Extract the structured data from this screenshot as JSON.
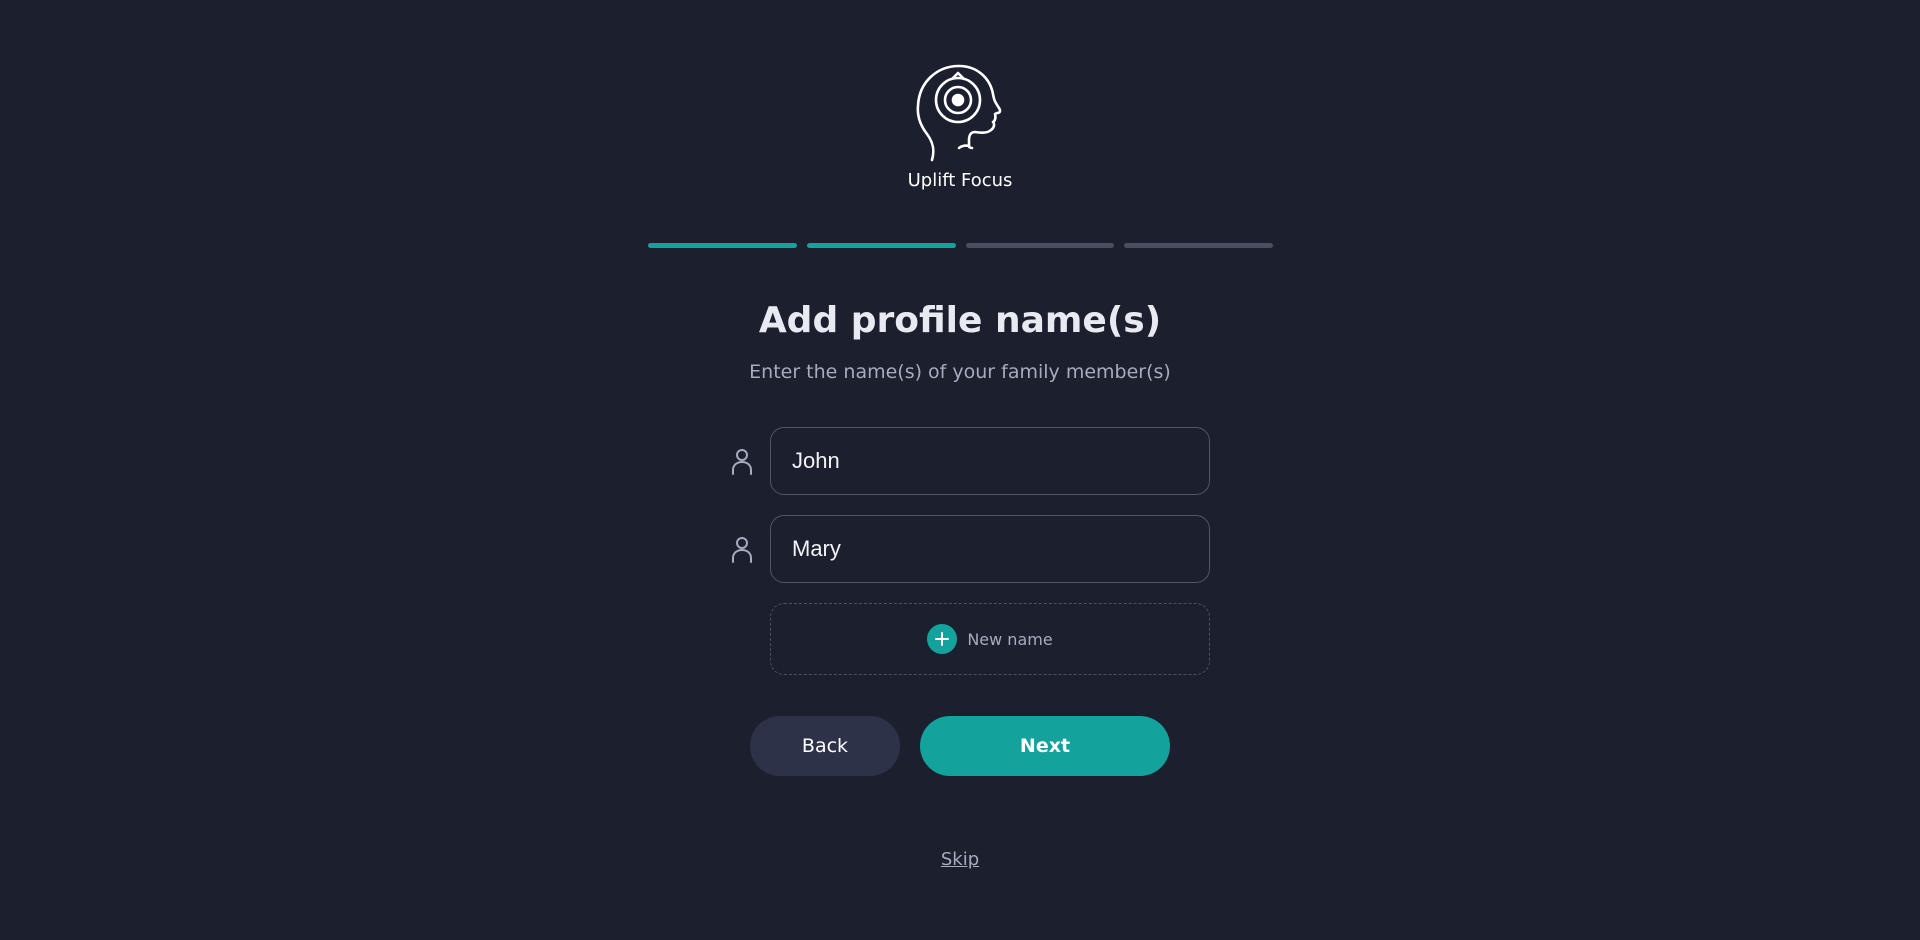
{
  "brand": {
    "name": "Uplift Focus",
    "logo_icon": "head-target-icon"
  },
  "progress": {
    "steps_total": 4,
    "steps_completed": 2,
    "active_color": "#13a29c",
    "inactive_color": "#4a4e63"
  },
  "main": {
    "title": "Add profile name(s)",
    "subtitle": "Enter the name(s) of your family member(s)",
    "names": [
      {
        "icon": "person-icon",
        "value": "John"
      },
      {
        "icon": "person-icon",
        "value": "Mary"
      }
    ],
    "add_name": {
      "icon": "plus-icon",
      "label": "New name"
    }
  },
  "actions": {
    "back_label": "Back",
    "next_label": "Next",
    "skip_label": "Skip"
  },
  "colors": {
    "background": "#1c1f2e",
    "accent": "#13a29c",
    "secondary_button": "#2d3249"
  }
}
